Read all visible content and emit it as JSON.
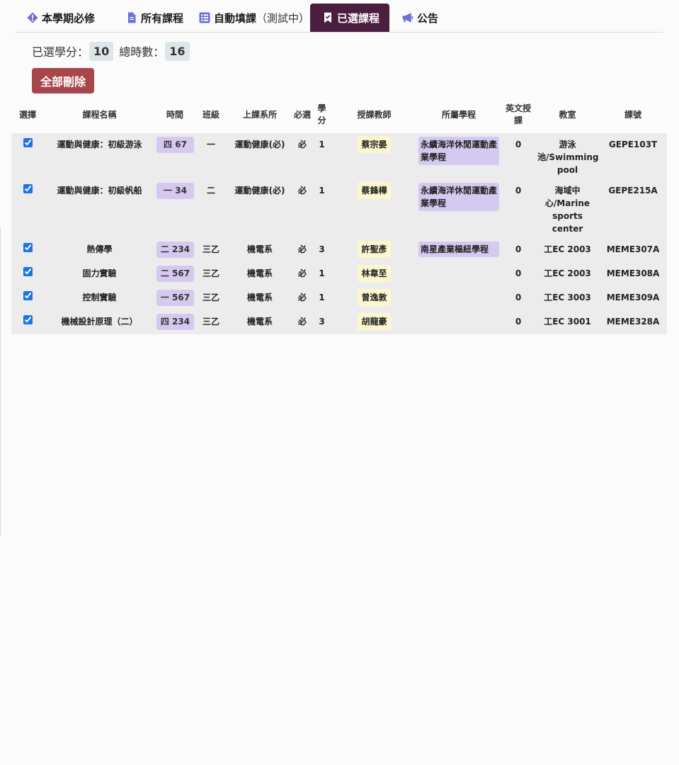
{
  "tabs": [
    {
      "label": "本學期必修",
      "suffix": "",
      "icon": "exclamation-diamond-icon"
    },
    {
      "label": "所有課程",
      "suffix": "",
      "icon": "file-icon"
    },
    {
      "label": "自動填課",
      "suffix": "（測試中）",
      "icon": "grid-list-icon"
    },
    {
      "label": "已選課程",
      "suffix": "",
      "icon": "bookmark-check-icon"
    },
    {
      "label": "公告",
      "suffix": "",
      "icon": "megaphone-icon"
    }
  ],
  "active_tab": 3,
  "summary": {
    "credits_label": "已選學分：",
    "credits_value": "10",
    "hours_label": "總時數：",
    "hours_value": "16"
  },
  "delete_all_label": "全部刪除",
  "table": {
    "headers": [
      "選擇",
      "課程名稱",
      "時間",
      "班級",
      "上課系所",
      "必選",
      "學分",
      "授課教師",
      "所屬學程",
      "英文授課",
      "教室",
      "課號"
    ],
    "rows": [
      {
        "checked": true,
        "name": "運動與健康：初級游泳",
        "time": "四 67",
        "class": "一",
        "dept": "運動健康(必)",
        "req": "必",
        "credits": "1",
        "teacher": "蔡宗晏",
        "program": "永續海洋休閒運動產業學程",
        "english": "0",
        "room": "游泳池/Swimming pool",
        "code": "GEPE103T"
      },
      {
        "checked": true,
        "name": "運動與健康：初級帆船",
        "time": "一 34",
        "class": "二",
        "dept": "運動健康(必)",
        "req": "必",
        "credits": "1",
        "teacher": "蔡鋒樺",
        "program": "永續海洋休閒運動產業學程",
        "english": "0",
        "room": "海域中心/Marine sports center",
        "code": "GEPE215A"
      },
      {
        "checked": true,
        "name": "熱傳學",
        "time": "二 234",
        "class": "三乙",
        "dept": "機電系",
        "req": "必",
        "credits": "3",
        "teacher": "許聖彥",
        "program": "南星產業樞紐學程",
        "english": "0",
        "room": "工EC 2003",
        "code": "MEME307A"
      },
      {
        "checked": true,
        "name": "固力實驗",
        "time": "二 567",
        "class": "三乙",
        "dept": "機電系",
        "req": "必",
        "credits": "1",
        "teacher": "林韋至",
        "program": "",
        "english": "0",
        "room": "工EC 2003",
        "code": "MEME308A"
      },
      {
        "checked": true,
        "name": "控制實驗",
        "time": "一 567",
        "class": "三乙",
        "dept": "機電系",
        "req": "必",
        "credits": "1",
        "teacher": "曾逸敦",
        "program": "",
        "english": "0",
        "room": "工EC 3003",
        "code": "MEME309A"
      },
      {
        "checked": true,
        "name": "機械設計原理（二）",
        "time": "四 234",
        "class": "三乙",
        "dept": "機電系",
        "req": "必",
        "credits": "3",
        "teacher": "胡龍豪",
        "program": "",
        "english": "0",
        "room": "工EC 3001",
        "code": "MEME328A"
      }
    ]
  },
  "colors": {
    "active_tab_bg": "#4a1e3e",
    "delete_button_bg": "#a8474b",
    "time_pill_bg": "#d5c9f0",
    "teacher_pill_bg": "#fcf7cf",
    "icon_accent": "#6b6fd8"
  }
}
